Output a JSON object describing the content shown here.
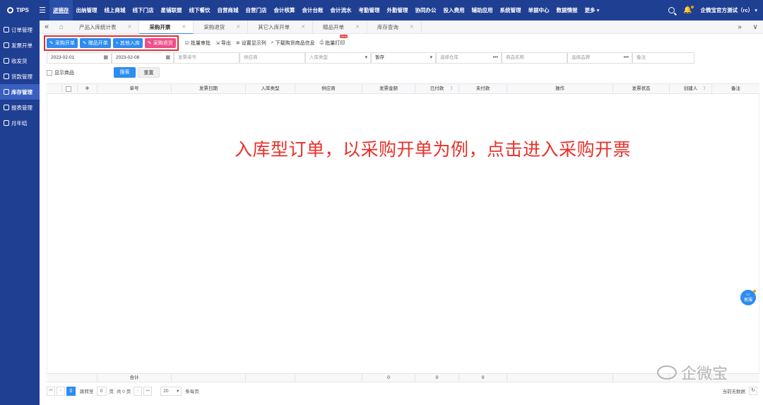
{
  "topbar": {
    "logo": "TIPS",
    "nav": [
      "进销存",
      "出纳管理",
      "线上商城",
      "线下门店",
      "星铺联盟",
      "线下餐饮",
      "自营商城",
      "自营门店",
      "会计核算",
      "会计台账",
      "会计流水",
      "考勤管理",
      "外勤管理",
      "协同办公",
      "投入费用",
      "辅助应用",
      "系统管理",
      "单据中心",
      "数据情报",
      "更多 ▾"
    ],
    "active_nav": "进销存",
    "user": "企微宝官方测试（rc） ▾"
  },
  "sidebar": {
    "items": [
      {
        "label": "订单管理"
      },
      {
        "label": "发票开单"
      },
      {
        "label": "收发货"
      },
      {
        "label": "货款管理"
      },
      {
        "label": "库存管理"
      },
      {
        "label": "报表管理"
      },
      {
        "label": "月年结"
      }
    ],
    "active": "库存管理"
  },
  "tabs": [
    {
      "label": "产品入库统计表"
    },
    {
      "label": "采购开票"
    },
    {
      "label": "采购退货"
    },
    {
      "label": "其它入库开单"
    },
    {
      "label": "赠品开单"
    },
    {
      "label": "库存查询"
    }
  ],
  "toolbar": {
    "boxed_buttons": [
      {
        "label": "采购开单",
        "color": "blue",
        "icon": "✎"
      },
      {
        "label": "赠品开单",
        "color": "blue",
        "icon": "✎"
      },
      {
        "label": "其他入库",
        "color": "blue",
        "icon": "+"
      },
      {
        "label": "采购退货",
        "color": "pink",
        "icon": "✎"
      }
    ],
    "links": [
      {
        "label": "批量审批",
        "icon": "☑"
      },
      {
        "label": "导出",
        "icon": "⇲"
      },
      {
        "label": "设置显示列",
        "icon": "✲"
      },
      {
        "label": "下载购货商品信息",
        "icon": "⌕"
      },
      {
        "label": "批量打印",
        "icon": "⎙"
      }
    ],
    "new_badge": "NEW"
  },
  "filters": {
    "date_start": "2023-02-01",
    "date_end": "2023-02-08",
    "invoice_no": "发票单号",
    "supplier": "供应商",
    "in_type": "入库类型",
    "status": "暂存",
    "warehouse": "选择仓库",
    "product": "商品名称",
    "brand": "选择品牌",
    "remark": "备注",
    "show_product": "显示商品",
    "search": "搜索",
    "reset": "重置"
  },
  "table": {
    "columns": [
      "单号",
      "发票日期",
      "入库类型",
      "供应商",
      "发票金额",
      "已付款",
      "未付款",
      "操作",
      "发票状态",
      "创建人",
      "备注"
    ],
    "footer": {
      "label": "合计",
      "amount": "0",
      "paid": "0",
      "unpaid": "0"
    }
  },
  "pager": {
    "current": "0",
    "goto_label": "跳转至",
    "goto_value": "0",
    "page_label": "页",
    "total": "共 0 页",
    "size": "20",
    "per_page": "条每页",
    "empty": "当前无数据"
  },
  "annotation": "入库型订单，以采购开单为例，点击进入采购开票",
  "service": "客服",
  "watermark": "企微宝",
  "colors": {
    "nav": "#1f3f93",
    "primary": "#2d8cf0",
    "danger": "#e23232",
    "pink": "#ec4f8a"
  }
}
